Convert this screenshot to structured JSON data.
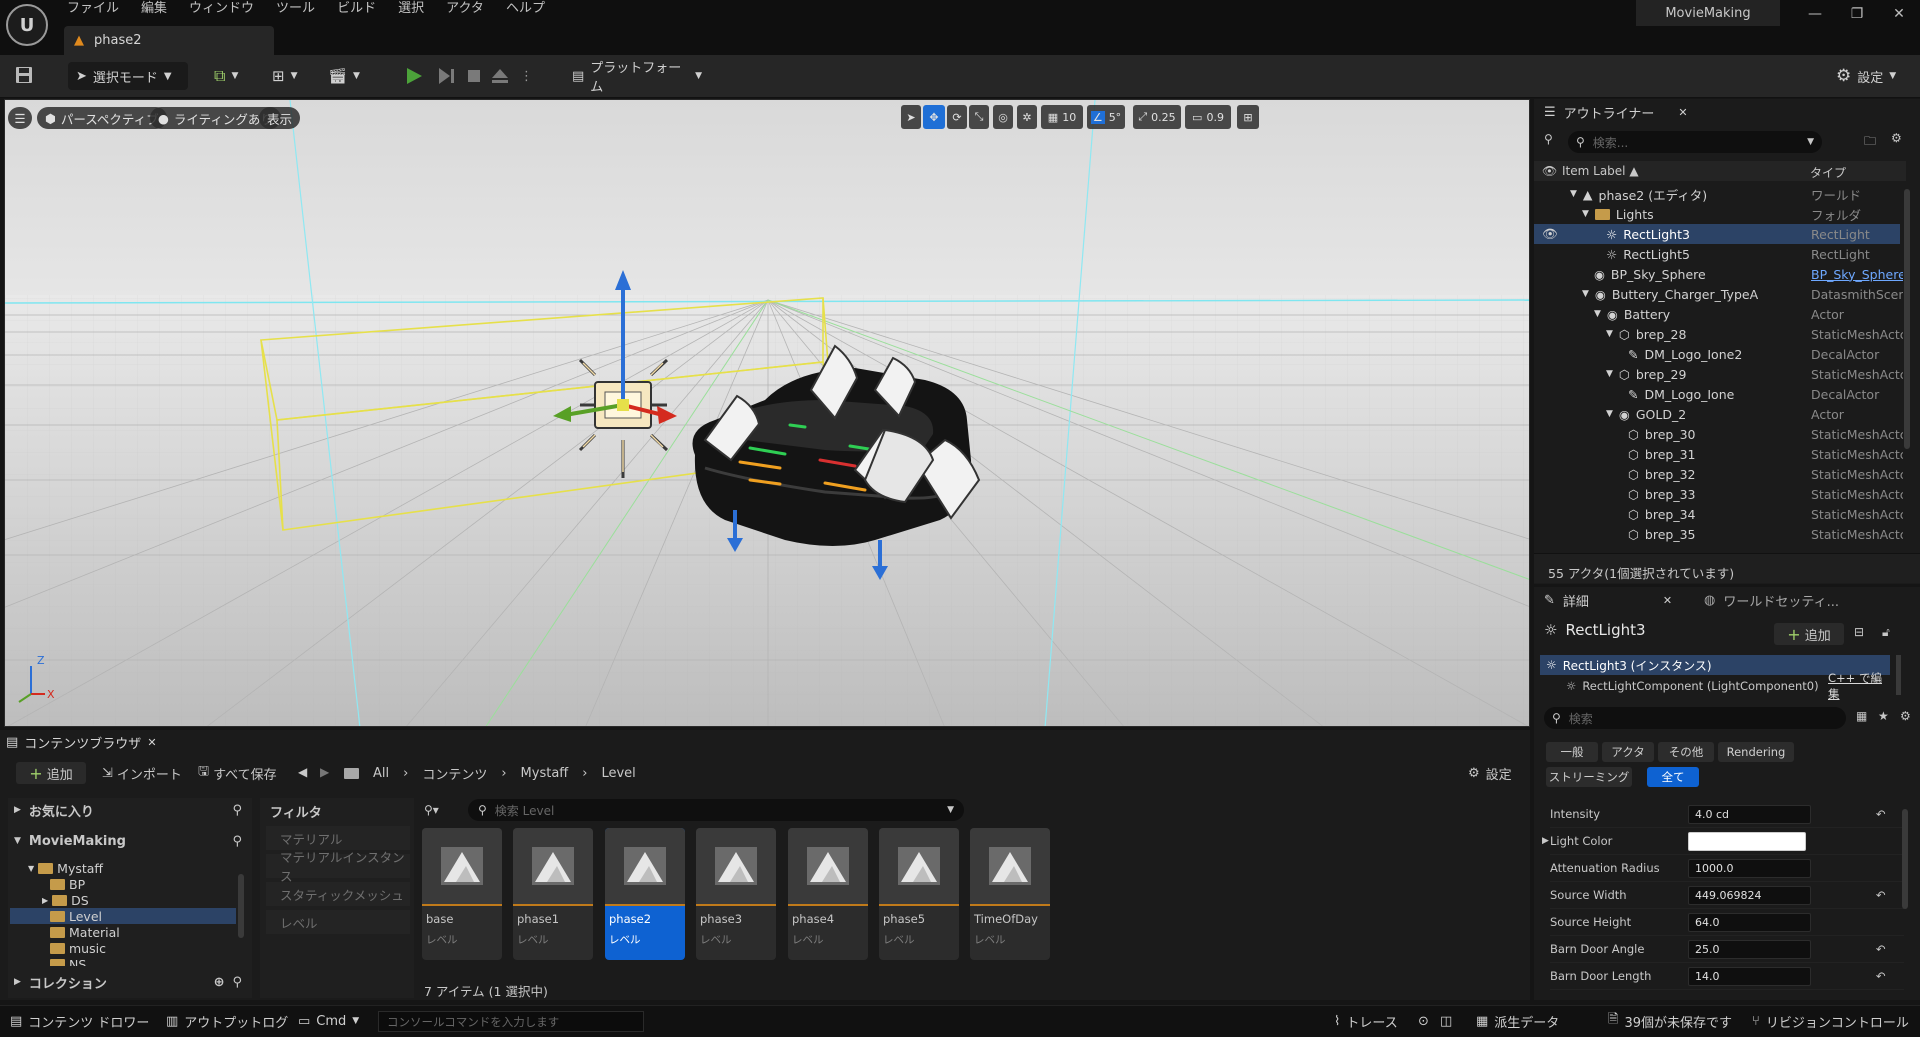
{
  "app": {
    "menu": [
      "ファイル",
      "編集",
      "ウィンドウ",
      "ツール",
      "ビルド",
      "選択",
      "アクタ",
      "ヘルプ"
    ],
    "level_tab": "phase2",
    "project_name": "MovieMaking"
  },
  "toolbar": {
    "mode": "選択モード",
    "platform": "プラットフォーム",
    "settings": "設定"
  },
  "viewport": {
    "perspective": "パースペクティブ",
    "lighting": "ライティングあり",
    "show": "表示",
    "grid_snap": "10",
    "rot_snap": "5°",
    "scale_snap": "0.25",
    "cam_speed": "0.9",
    "axis_z": "Z",
    "axis_x": "X"
  },
  "outliner": {
    "tab": "アウトライナー",
    "search_placeholder": "検索...",
    "col_label": "Item Label ▲",
    "col_type": "タイプ",
    "rows": [
      {
        "label": "phase2 (エディタ)",
        "type": "ワールド"
      },
      {
        "label": "Lights",
        "type": "フォルダ"
      },
      {
        "label": "RectLight3",
        "type": "RectLight"
      },
      {
        "label": "RectLight5",
        "type": "RectLight"
      },
      {
        "label": "BP_Sky_Sphere",
        "type": "BP_Sky_Sphere"
      },
      {
        "label": "Buttery_Charger_TypeA",
        "type": "DatasmithScen"
      },
      {
        "label": "Battery",
        "type": "Actor"
      },
      {
        "label": "brep_28",
        "type": "StaticMeshActc"
      },
      {
        "label": "DM_Logo_Ione2",
        "type": "DecalActor"
      },
      {
        "label": "brep_29",
        "type": "StaticMeshActc"
      },
      {
        "label": "DM_Logo_Ione",
        "type": "DecalActor"
      },
      {
        "label": "GOLD_2",
        "type": "Actor"
      },
      {
        "label": "brep_30",
        "type": "StaticMeshActc"
      },
      {
        "label": "brep_31",
        "type": "StaticMeshActc"
      },
      {
        "label": "brep_32",
        "type": "StaticMeshActc"
      },
      {
        "label": "brep_33",
        "type": "StaticMeshActc"
      },
      {
        "label": "brep_34",
        "type": "StaticMeshActc"
      },
      {
        "label": "brep_35",
        "type": "StaticMeshActc"
      }
    ],
    "footer": "55 アクタ(1個選択されています)"
  },
  "details": {
    "tab": "詳細",
    "tab2": "ワールドセッティ...",
    "actor": "RectLight3",
    "add": "追加",
    "instance": "RectLight3 (インスタンス)",
    "component": "RectLightComponent (LightComponent0)",
    "cpp_edit": "C++ で編集",
    "search_placeholder": "検索",
    "chips": [
      "一般",
      "アクタ",
      "その他",
      "Rendering",
      "ストリーミング",
      "全て"
    ],
    "props": [
      {
        "name": "Intensity",
        "value": "4.0 cd"
      },
      {
        "name": "Light Color",
        "value": ""
      },
      {
        "name": "Attenuation Radius",
        "value": "1000.0"
      },
      {
        "name": "Source Width",
        "value": "449.069824"
      },
      {
        "name": "Source Height",
        "value": "64.0"
      },
      {
        "name": "Barn Door Angle",
        "value": "25.0"
      },
      {
        "name": "Barn Door Length",
        "value": "14.0"
      }
    ]
  },
  "content_browser": {
    "tab": "コンテンツブラウザ",
    "add": "追加",
    "import": "インポート",
    "save_all": "すべて保存",
    "path": [
      "All",
      "コンテンツ",
      "Mystaff",
      "Level"
    ],
    "settings": "設定",
    "favorites": "お気に入り",
    "project": "MovieMaking",
    "collection": "コレクション",
    "folders": [
      "Mystaff",
      "BP",
      "DS",
      "Level",
      "Material",
      "music",
      "NS"
    ],
    "filter_title": "フィルタ",
    "filters": [
      "マテリアル",
      "マテリアルインスタンス",
      "スタティックメッシュ",
      "レベル"
    ],
    "search_placeholder": "検索 Level",
    "assets": [
      {
        "name": "base",
        "type": "レベル"
      },
      {
        "name": "phase1",
        "type": "レベル"
      },
      {
        "name": "phase2",
        "type": "レベル"
      },
      {
        "name": "phase3",
        "type": "レベル"
      },
      {
        "name": "phase4",
        "type": "レベル"
      },
      {
        "name": "phase5",
        "type": "レベル"
      },
      {
        "name": "TimeOfDay",
        "type": "レベル"
      }
    ],
    "count": "7 アイテム (1 選択中)"
  },
  "statusbar": {
    "drawer": "コンテンツ ドロワー",
    "output_log": "アウトプットログ",
    "cmd": "Cmd",
    "console_placeholder": "コンソールコマンドを入力します",
    "trace": "トレース",
    "derived": "派生データ",
    "unsaved": "39個が未保存です",
    "revision": "リビジョンコントロール"
  }
}
